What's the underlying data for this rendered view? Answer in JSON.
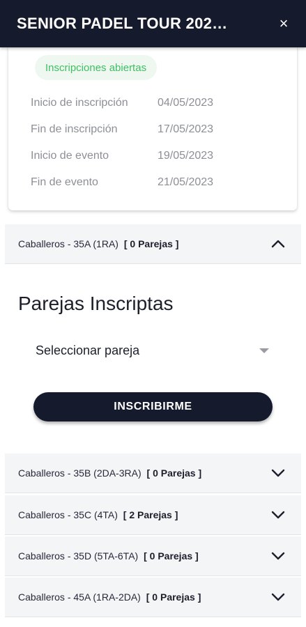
{
  "header": {
    "title": "SENIOR PADEL TOUR 202…",
    "close_icon": "×"
  },
  "event_card": {
    "status": "Inscripciones abiertas",
    "rows": [
      {
        "label": "Inicio de inscripción",
        "value": "04/05/2023"
      },
      {
        "label": "Fin de inscripción",
        "value": "17/05/2023"
      },
      {
        "label": "Inicio de evento",
        "value": "19/05/2023"
      },
      {
        "label": "Fin de evento",
        "value": "21/05/2023"
      }
    ]
  },
  "categories": [
    {
      "name": "Caballeros - 35A (1RA)",
      "count": "[ 0 Parejas ]",
      "expanded": true
    },
    {
      "name": "Caballeros - 35B (2DA-3RA)",
      "count": "[ 0 Parejas ]",
      "expanded": false
    },
    {
      "name": "Caballeros - 35C (4TA)",
      "count": "[ 2 Parejas ]",
      "expanded": false
    },
    {
      "name": "Caballeros - 35D (5TA-6TA)",
      "count": "[ 0 Parejas ]",
      "expanded": false
    },
    {
      "name": "Caballeros - 45A (1RA-2DA)",
      "count": "[ 0 Parejas ]",
      "expanded": false
    }
  ],
  "panel": {
    "title": "Parejas Inscriptas",
    "select_placeholder": "Seleccionar pareja",
    "button_label": "INSCRIBIRME"
  },
  "colors": {
    "header_bg": "#161a2d",
    "status_green": "#3fbf62"
  }
}
